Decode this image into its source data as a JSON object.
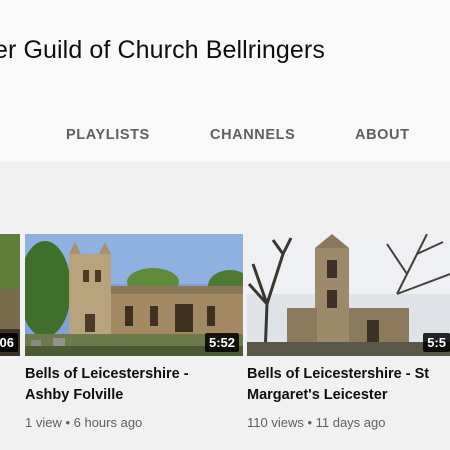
{
  "channel": {
    "title": "er Guild of Church Bellringers"
  },
  "tabs": [
    {
      "label": "PLAYLISTS"
    },
    {
      "label": "CHANNELS"
    },
    {
      "label": "ABOUT"
    }
  ],
  "videos": [
    {
      "duration": "06",
      "title_line1": "",
      "title_line2": "",
      "meta": ""
    },
    {
      "duration": "5:52",
      "title_line1": "Bells of Leicestershire -",
      "title_line2": "Ashby Folville",
      "meta": "1 view • 6 hours ago"
    },
    {
      "duration": "5:5",
      "title_line1": "Bells of Leicestershire - St",
      "title_line2": "Margaret's Leicester",
      "meta": "110 views • 11 days ago"
    }
  ],
  "colors": {
    "background": "#f9f9f9",
    "content_bg": "#f1f1f1",
    "tab_text": "#606060",
    "title_text": "#0f0f0f"
  }
}
